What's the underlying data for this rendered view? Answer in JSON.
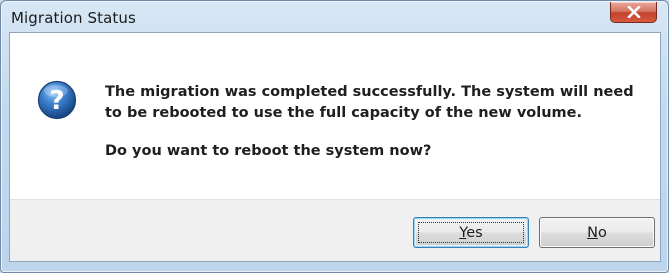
{
  "window": {
    "title": "Migration Status"
  },
  "dialog": {
    "icon": "question-icon",
    "message": "The migration was completed successfully. The system will need to be rebooted to use the full capacity of the new volume.",
    "question": "Do you want to reboot the system now?"
  },
  "buttons": {
    "yes": {
      "accel": "Y",
      "rest": "es"
    },
    "no": {
      "accel": "N",
      "rest": "o"
    }
  },
  "colors": {
    "icon_blue": "#2a6bb5",
    "close_red": "#c4422d"
  }
}
